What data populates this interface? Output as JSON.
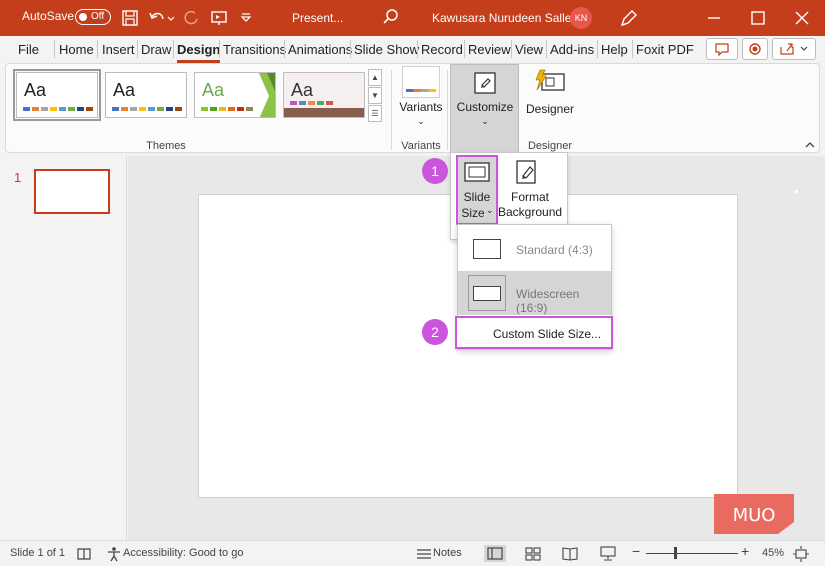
{
  "titlebar": {
    "autosave_label": "AutoSave",
    "toggle_state": "Off",
    "doc_title": "Present...",
    "user_name": "Kawusara Nurudeen Salley",
    "avatar_initials": "KN",
    "accent": "#c43e1c"
  },
  "menu": {
    "items": [
      "File",
      "Home",
      "Insert",
      "Draw",
      "Design",
      "Transitions",
      "Animations",
      "Slide Show",
      "Record",
      "Review",
      "View",
      "Add-ins",
      "Help",
      "Foxit PDF"
    ],
    "active": "Design"
  },
  "ribbon": {
    "themes_label": "Themes",
    "theme_tiles": [
      "Aa",
      "Aa",
      "Aa",
      "Aa"
    ],
    "variants_label": "Variants",
    "variants_group": "Variants",
    "customize_label": "Customize",
    "designer_label": "Designer",
    "designer_group": "Designer"
  },
  "customize_panel": {
    "slide_size_line1": "Slide",
    "slide_size_line2": "Size",
    "format_bg_line1": "Format",
    "format_bg_line2": "Background"
  },
  "slide_size_menu": {
    "standard": "Standard (4:3)",
    "widescreen": "Widescreen (16:9)",
    "custom": "Custom Slide Size..."
  },
  "steps": [
    "1",
    "2"
  ],
  "thumbnails": {
    "slide_number": "1"
  },
  "statusbar": {
    "slide_count": "Slide 1 of 1",
    "accessibility": "Accessibility: Good to go",
    "notes": "Notes",
    "zoom": "45%",
    "zoom_level": 0.45
  },
  "watermark": "MUO",
  "colors": {
    "highlight": "#cc55dd",
    "brand": "#c43e1c"
  }
}
